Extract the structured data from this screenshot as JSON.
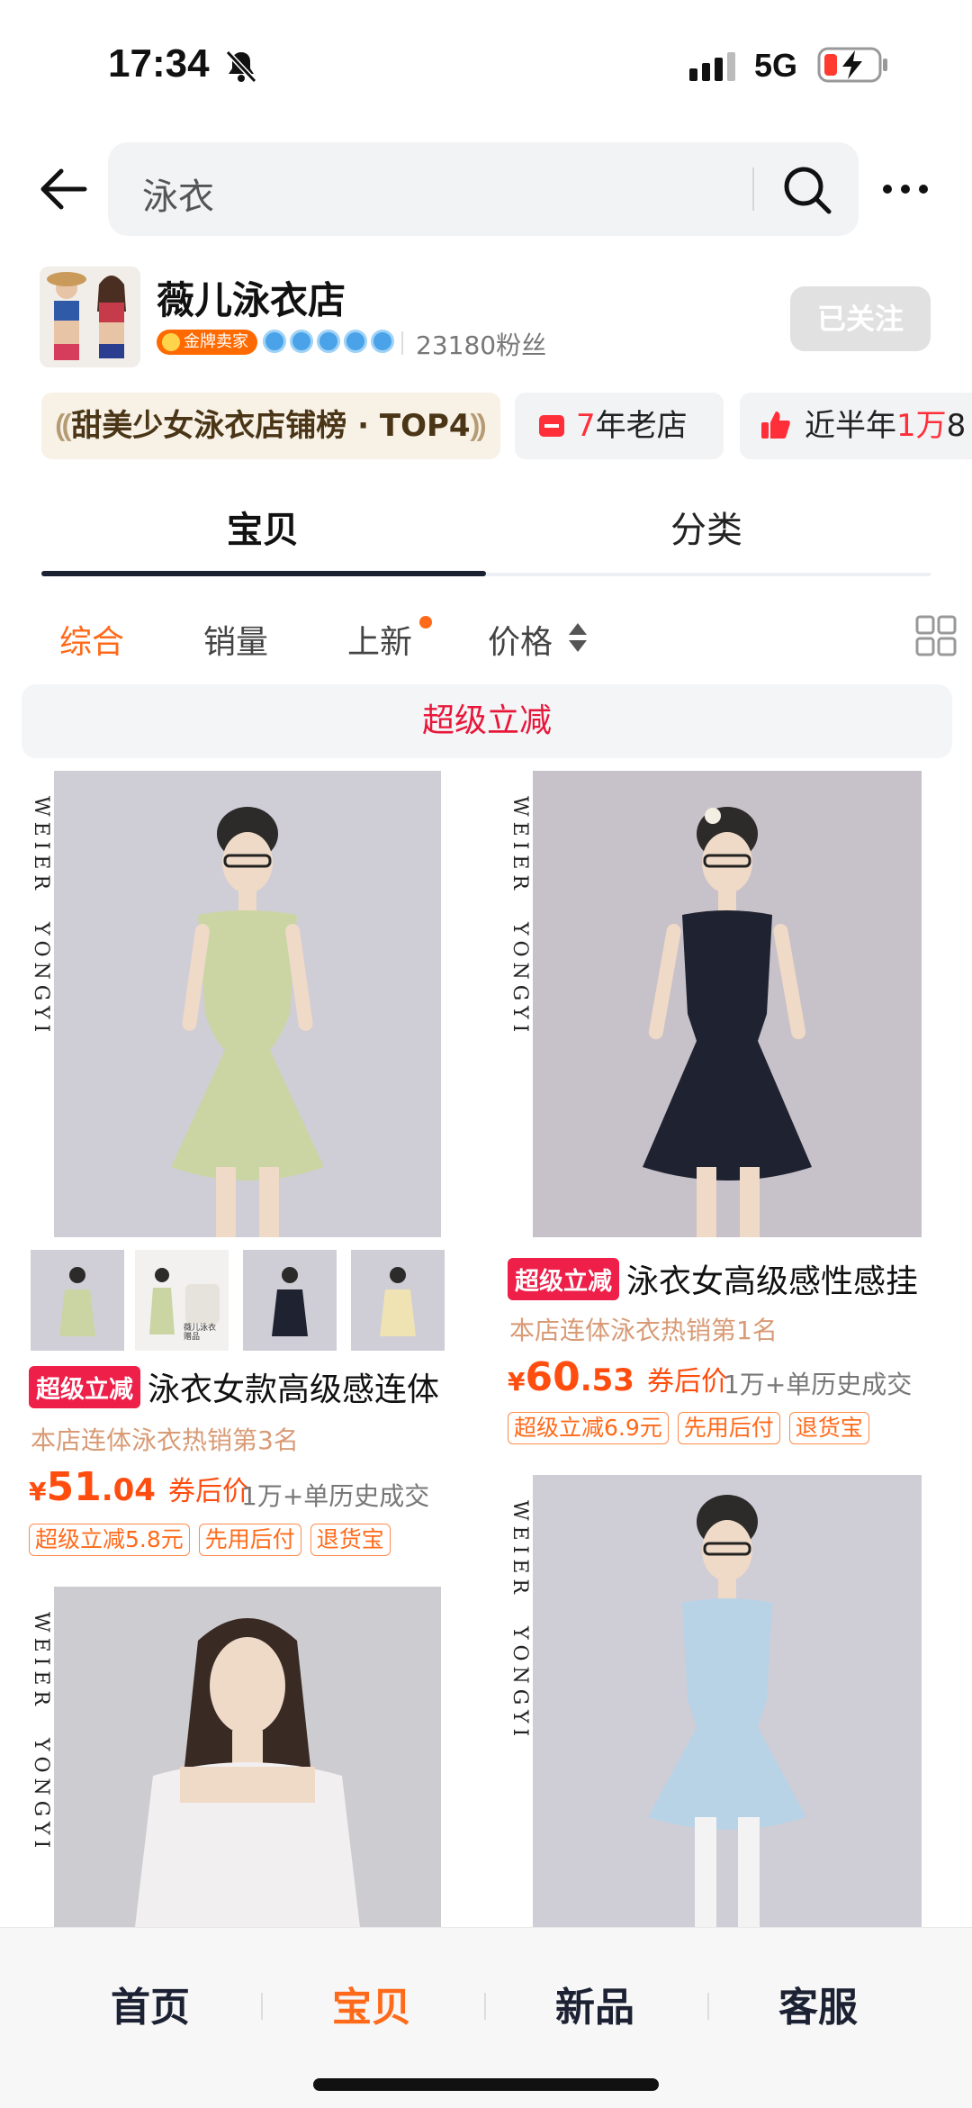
{
  "status": {
    "time": "17:34",
    "network": "5G"
  },
  "search": {
    "query": "泳衣"
  },
  "shop": {
    "name": "薇儿泳衣店",
    "badge": "金牌卖家",
    "fans": "23180粉丝",
    "follow_label": "已关注"
  },
  "tags": {
    "rank": "甜美少女泳衣店铺榜 · TOP4",
    "age_num": "7",
    "age_text": "年老店",
    "half_year_prefix": "近半年",
    "half_year_num": "1万",
    "half_year_suffix": "8"
  },
  "tabs": [
    "宝贝",
    "分类"
  ],
  "sort": {
    "zonghe": "综合",
    "xiaoliang": "销量",
    "shangxin": "上新",
    "jiage": "价格"
  },
  "promo": {
    "label": "超级立减"
  },
  "brand_vertical": [
    "WEIER",
    "YONGYI"
  ],
  "products": [
    {
      "tag": "超级立减",
      "title": "泳衣女款高级感连体",
      "rank": "本店连体泳衣热销第3名",
      "price_yen": "¥",
      "price_int": "51",
      "price_dec": ".04",
      "price_after": "券后价",
      "sold": "1万+单历史成交",
      "chips": [
        "超级立减5.8元",
        "先用后付",
        "退货宝"
      ],
      "thumb_caption": "薇儿泳衣 赠品"
    },
    {
      "tag": "超级立减",
      "title": "泳衣女高级感性感挂",
      "rank": "本店连体泳衣热销第1名",
      "price_yen": "¥",
      "price_int": "60",
      "price_dec": ".53",
      "price_after": "券后价",
      "sold": "1万+单历史成交",
      "chips": [
        "超级立减6.9元",
        "先用后付",
        "退货宝"
      ]
    }
  ],
  "bottom_nav": [
    "首页",
    "宝贝",
    "新品",
    "客服"
  ],
  "colors": {
    "accent": "#ff6a1a",
    "promo_red": "#e8173a",
    "price": "#ff4d0f"
  },
  "icons": [
    "bell-slash-icon",
    "signal-icon",
    "battery-charging-icon",
    "back-arrow-icon",
    "search-icon",
    "more-icon",
    "grid-view-icon",
    "sort-arrows-icon",
    "thumbs-up-icon",
    "shop-icon"
  ]
}
